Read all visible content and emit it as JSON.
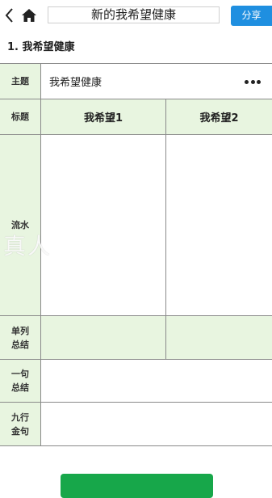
{
  "header": {
    "title": "新的我希望健康",
    "share_label": "分享"
  },
  "section": {
    "title": "1. 我希望健康"
  },
  "table": {
    "rows": [
      {
        "label": "主题",
        "value": "我希望健康"
      },
      {
        "label": "标题",
        "col1": "我希望1",
        "col2": "我希望2"
      },
      {
        "label": "流水"
      },
      {
        "label": "单列\n总结"
      },
      {
        "label": "一句\n总结"
      },
      {
        "label": "九行\n金句"
      }
    ]
  },
  "watermark_text": "真人",
  "colors": {
    "accent_blue": "#1f8fe0",
    "label_green": "#e8f5e0",
    "button_green": "#17a74a"
  }
}
